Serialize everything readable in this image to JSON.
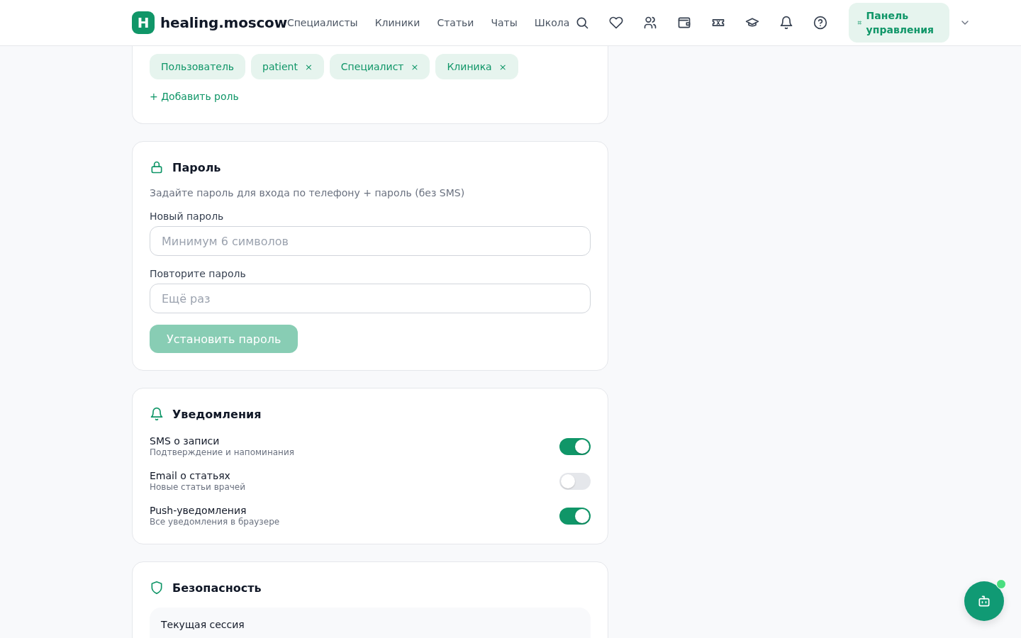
{
  "header": {
    "logo_letter": "H",
    "site_name": "healing.moscow",
    "nav": [
      "Специалисты",
      "Клиники",
      "Статьи",
      "Чаты",
      "Школа"
    ],
    "panel_button": "Панель управления"
  },
  "roles": {
    "chips": [
      {
        "label": "Пользователь",
        "removable": false
      },
      {
        "label": "patient",
        "removable": true,
        "remove": "×"
      },
      {
        "label": "Специалист",
        "removable": true,
        "remove": "×"
      },
      {
        "label": "Клиника",
        "removable": true,
        "remove": "×"
      }
    ],
    "add_link": "+ Добавить роль"
  },
  "password": {
    "title": "Пароль",
    "description": "Задайте пароль для входа по телефону + пароль (без SMS)",
    "fields": [
      {
        "label": "Новый пароль",
        "placeholder": "Минимум 6 символов"
      },
      {
        "label": "Повторите пароль",
        "placeholder": "Ещё раз"
      }
    ],
    "submit": {
      "label": "Установить пароль",
      "disabled": true
    }
  },
  "notifications": {
    "title": "Уведомления",
    "items": [
      {
        "title": "SMS о записи",
        "subtitle": "Подтверждение и напоминания",
        "on": true
      },
      {
        "title": "Email о статьях",
        "subtitle": "Новые статьи врачей",
        "on": false
      },
      {
        "title": "Push-уведомления",
        "subtitle": "Все уведомления в браузере",
        "on": true
      }
    ]
  },
  "security": {
    "title": "Безопасность",
    "session_label": "Текущая сессия"
  }
}
